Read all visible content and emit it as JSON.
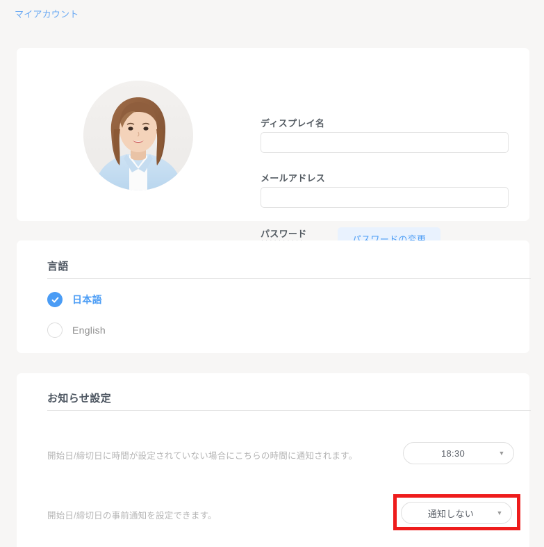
{
  "breadcrumb": {
    "label": "マイアカウント"
  },
  "profile": {
    "avatar_alt": "user-avatar-photo",
    "display_name": {
      "label": "ディスプレイ名",
      "value": "",
      "placeholder": ""
    },
    "email": {
      "label": "メールアドレス",
      "value": "",
      "placeholder": ""
    },
    "password": {
      "label": "パスワード",
      "masked_value": "**********",
      "change_button": "パスワードの変更"
    }
  },
  "language": {
    "title": "言語",
    "options": [
      {
        "label": "日本語",
        "selected": true
      },
      {
        "label": "English",
        "selected": false
      }
    ]
  },
  "notification": {
    "title": "お知らせ設定",
    "rows": [
      {
        "description": "開始日/締切日に時間が設定されていない場合にこちらの時間に通知されます。",
        "value": "18:30",
        "caret": "▼"
      },
      {
        "description": "開始日/締切日の事前通知を設定できます。",
        "value": "通知しない",
        "caret": "▼",
        "highlighted": true
      }
    ]
  },
  "colors": {
    "accent": "#4a9cf5",
    "page_background": "#f7f6f5",
    "card_background": "#ffffff",
    "annotation": "#ee1c1c",
    "muted_text": "#b6b6b6"
  }
}
